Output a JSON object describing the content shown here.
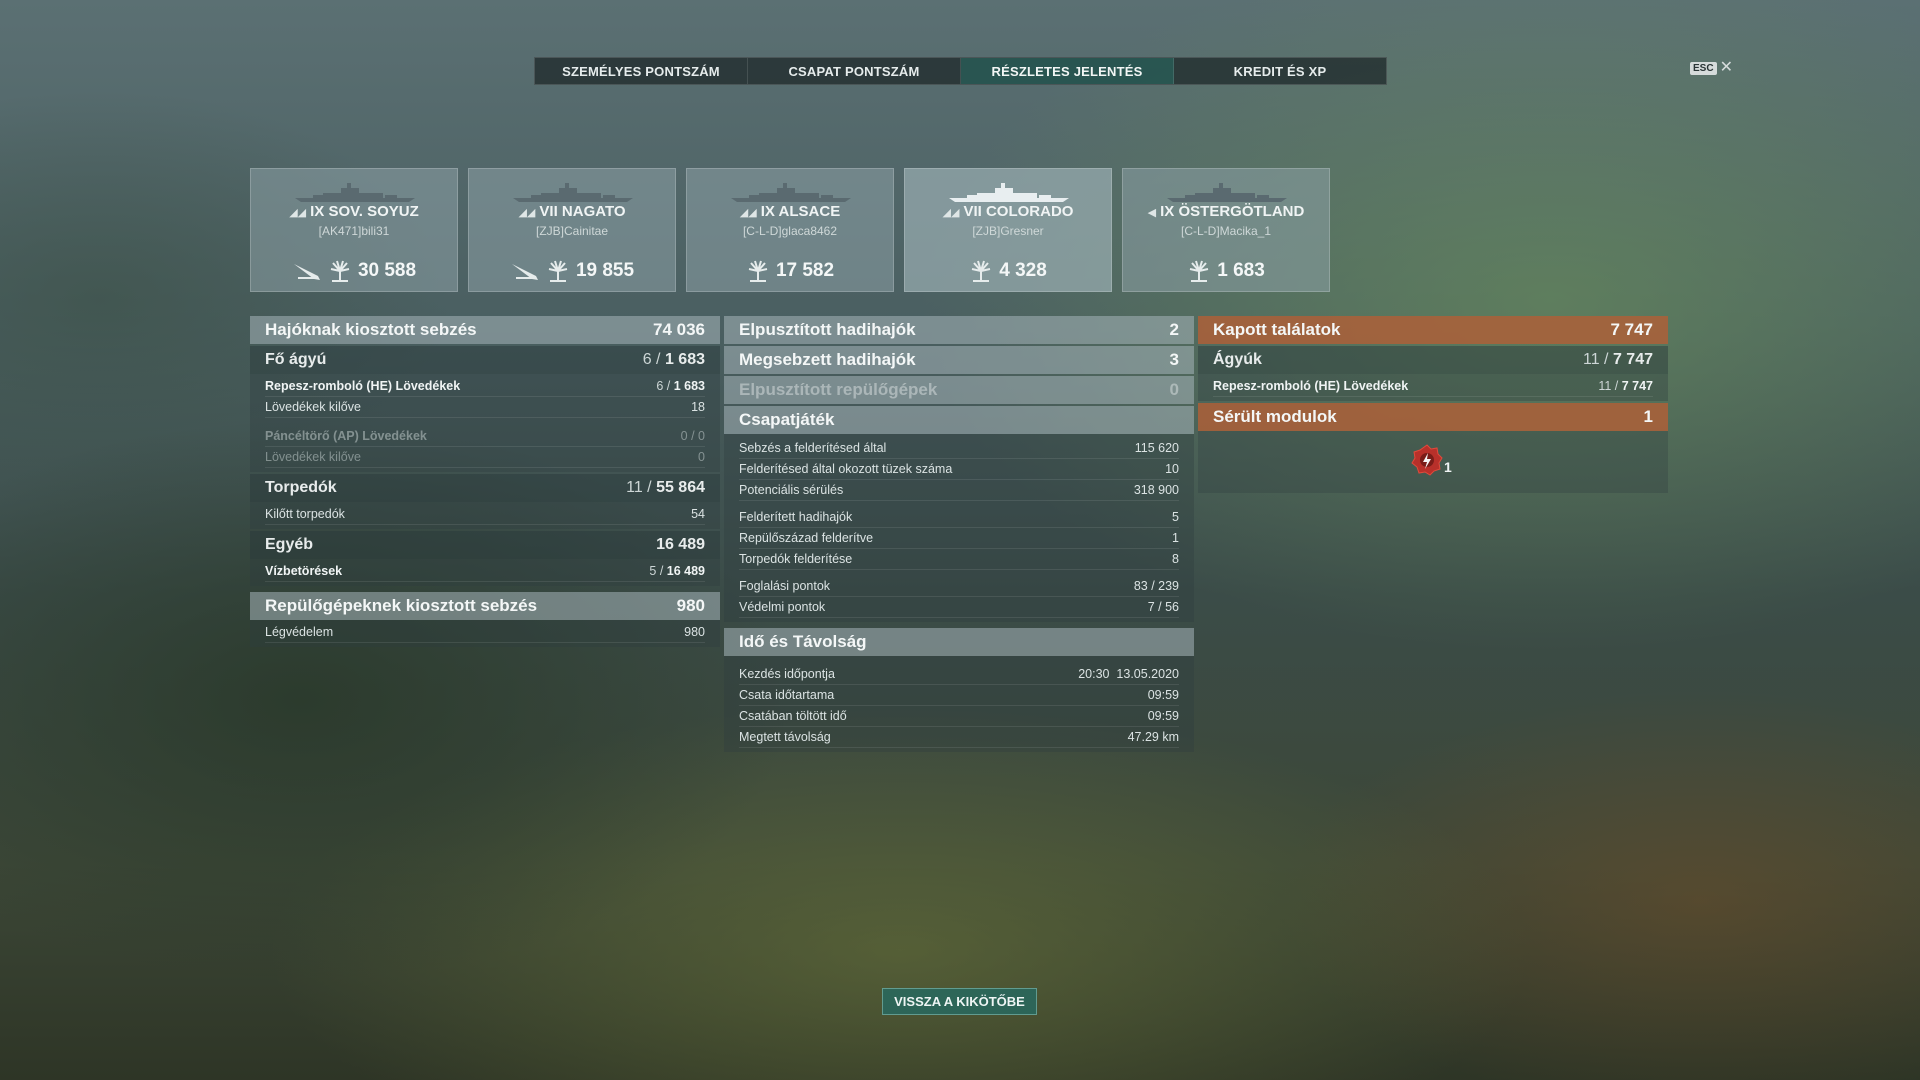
{
  "tabs": [
    {
      "label": "SZEMÉLYES PONTSZÁM",
      "active": false
    },
    {
      "label": "CSAPAT PONTSZÁM",
      "active": false
    },
    {
      "label": "RÉSZLETES JELENTÉS",
      "active": true
    },
    {
      "label": "KREDIT ÉS XP",
      "active": false
    }
  ],
  "esc_label": "ESC",
  "ships": [
    {
      "tier": "IX",
      "name": "SOV. SOYUZ",
      "player": "[AK471]bili31",
      "damage": "30 588",
      "torpedo_icon": true
    },
    {
      "tier": "VII",
      "name": "NAGATO",
      "player": "[ZJB]Cainitae",
      "damage": "19 855",
      "torpedo_icon": true
    },
    {
      "tier": "IX",
      "name": "ALSACE",
      "player": "[C-L-D]glaca8462",
      "damage": "17 582",
      "torpedo_icon": false
    },
    {
      "tier": "VII",
      "name": "COLORADO",
      "player": "[ZJB]Gresner",
      "damage": "4 328",
      "torpedo_icon": false
    },
    {
      "tier": "IX",
      "name": "ÖSTERGÖTLAND",
      "player": "[C-L-D]Macika_1",
      "damage": "1 683",
      "torpedo_icon": false
    }
  ],
  "left": {
    "ship_damage": {
      "label": "Hajóknak kiosztott sebzés",
      "value": "74 036"
    },
    "main_battery": {
      "label": "Fő ágyú",
      "hits": "6",
      "damage": "1 683"
    },
    "he": {
      "label": "Repesz-romboló (HE) Lövedékek",
      "hits": "6",
      "damage": "1 683"
    },
    "he_fired": {
      "label": "Lövedékek kilőve",
      "value": "18"
    },
    "ap": {
      "label": "Páncéltörő (AP) Lövedékek",
      "value": "0 / 0"
    },
    "ap_fired": {
      "label": "Lövedékek kilőve",
      "value": "0"
    },
    "torpedoes": {
      "label": "Torpedók",
      "hits": "11",
      "damage": "55 864"
    },
    "torps_fired": {
      "label": "Kilőtt torpedók",
      "value": "54"
    },
    "other": {
      "label": "Egyéb",
      "value": "16 489"
    },
    "flooding": {
      "label": "Vízbetörések",
      "hits": "5",
      "damage": "16 489"
    },
    "plane_damage": {
      "label": "Repülőgépeknek kiosztott sebzés",
      "value": "980"
    },
    "aa": {
      "label": "Légvédelem",
      "value": "980"
    }
  },
  "middle": {
    "destroyed": {
      "label": "Elpusztított hadihajók",
      "value": "2"
    },
    "damaged": {
      "label": "Megsebzett hadihajók",
      "value": "3"
    },
    "planes": {
      "label": "Elpusztított repülőgépek",
      "value": "0"
    },
    "teamplay": {
      "label": "Csapatjáték"
    },
    "spot_damage": {
      "label": "Sebzés a felderítésed által",
      "value": "115 620"
    },
    "spot_fires": {
      "label": "Felderítésed által okozott tüzek száma",
      "value": "10"
    },
    "potential": {
      "label": "Potenciális sérülés",
      "value": "318 900"
    },
    "spotted_ships": {
      "label": "Felderített hadihajók",
      "value": "5"
    },
    "spotted_squad": {
      "label": "Repülőszázad felderítve",
      "value": "1"
    },
    "spotted_torps": {
      "label": "Torpedók felderítése",
      "value": "8"
    },
    "capture": {
      "label": "Foglalási pontok",
      "value": "83 / 239"
    },
    "defense": {
      "label": "Védelmi pontok",
      "value": "7 / 56"
    },
    "time": {
      "label": "Idő és Távolság"
    },
    "start": {
      "label": "Kezdés időpontja",
      "value": "20:30  13.05.2020"
    },
    "duration": {
      "label": "Csata időtartama",
      "value": "09:59"
    },
    "time_in_battle": {
      "label": "Csatában töltött idő",
      "value": "09:59"
    },
    "distance": {
      "label": "Megtett távolság",
      "value": "47.29 km"
    }
  },
  "right": {
    "received": {
      "label": "Kapott találatok",
      "value": "7 747"
    },
    "guns": {
      "label": "Ágyúk",
      "hits": "11",
      "damage": "7 747"
    },
    "he": {
      "label": "Repesz-romboló (HE) Lövedékek",
      "hits": "11",
      "damage": "7 747"
    },
    "modules": {
      "label": "Sérült modulok",
      "value": "1"
    },
    "module_count": "1"
  },
  "back_button": "VISSZA A KIKÖTŐBE",
  "colors": {
    "accent": "#286e64",
    "received": "#b05f37"
  }
}
